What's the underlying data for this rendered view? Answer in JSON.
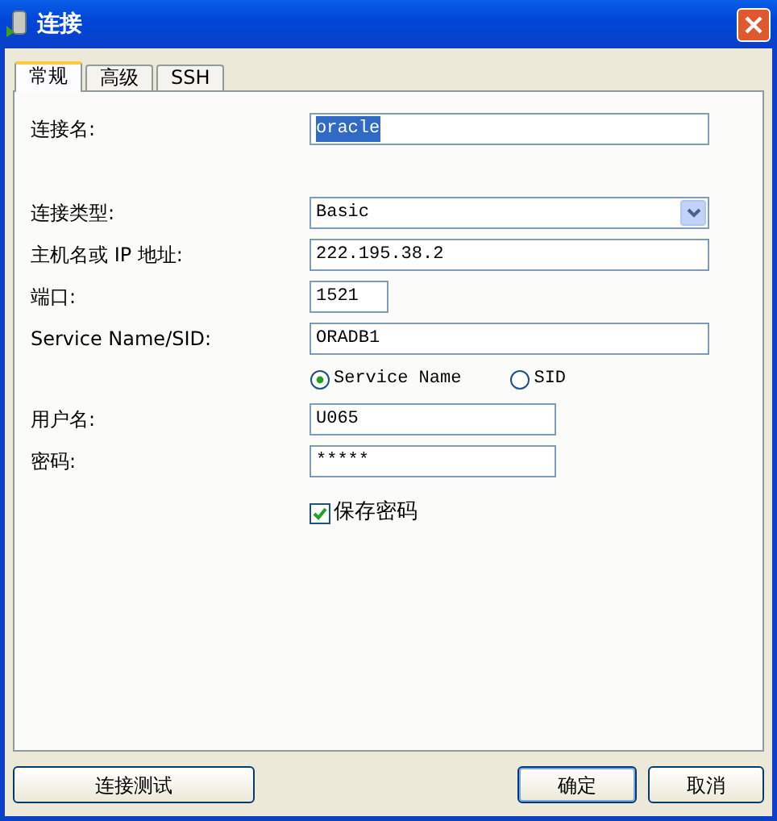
{
  "window": {
    "title": "连接"
  },
  "tabs": [
    {
      "label": "常规",
      "selected": true
    },
    {
      "label": "高级",
      "selected": false
    },
    {
      "label": "SSH",
      "selected": false
    }
  ],
  "form": [
    {
      "kind": "text",
      "label": "连接名:",
      "value": "oracle",
      "highlighted": true
    },
    {
      "kind": "select",
      "label": "连接类型:",
      "value": "Basic"
    },
    {
      "kind": "text",
      "label": "主机名或 IP 地址:",
      "value": "222.195.38.2",
      "highlighted": false
    },
    {
      "kind": "short",
      "label": "端口:",
      "value": "1521",
      "highlighted": false
    },
    {
      "kind": "text",
      "label": "Service Name/SID:",
      "value": "ORADB1",
      "highlighted": false
    },
    {
      "kind": "radios",
      "options": [
        {
          "label": "Service Name",
          "selected": true
        },
        {
          "label": "SID",
          "selected": false
        }
      ]
    },
    {
      "kind": "medium",
      "label": "用户名:",
      "value": "U065",
      "highlighted": false
    },
    {
      "kind": "medium",
      "label": "密码:",
      "value": "*****",
      "highlighted": false
    },
    {
      "kind": "checkbox",
      "label": "保存密码",
      "checked": true
    }
  ],
  "buttons": [
    {
      "label": "连接测试",
      "default": false
    },
    {
      "label": "确定",
      "default": true
    },
    {
      "label": "取消",
      "default": false
    }
  ]
}
